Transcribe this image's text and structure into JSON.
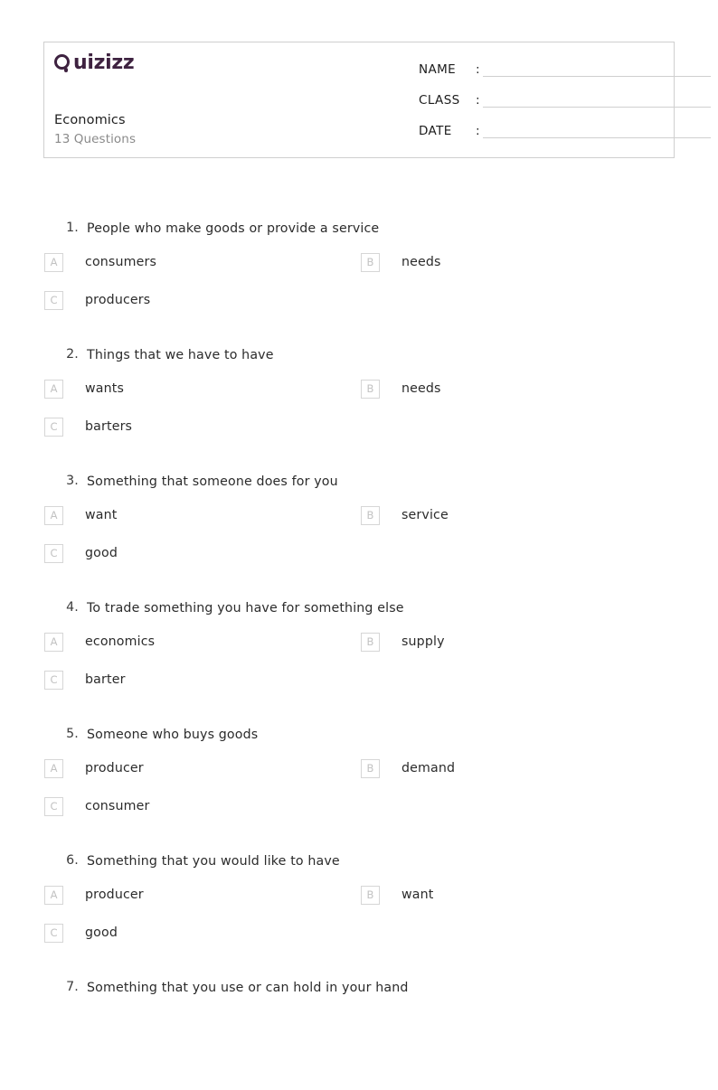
{
  "header": {
    "logo_text": "Quizizz",
    "logo_color": "#3e2240",
    "quiz_title": "Economics",
    "question_count_label": "13 Questions",
    "fields": [
      {
        "label": "NAME",
        "colon": ":",
        "value": ""
      },
      {
        "label": "CLASS",
        "colon": ":",
        "value": ""
      },
      {
        "label": "DATE",
        "colon": ":",
        "value": ""
      }
    ]
  },
  "questions": [
    {
      "number": "1.",
      "text": "People who make goods or provide a service",
      "options": [
        {
          "letter": "A",
          "text": "consumers"
        },
        {
          "letter": "B",
          "text": "needs"
        },
        {
          "letter": "C",
          "text": "producers"
        }
      ]
    },
    {
      "number": "2.",
      "text": "Things that we have to have",
      "options": [
        {
          "letter": "A",
          "text": "wants"
        },
        {
          "letter": "B",
          "text": "needs"
        },
        {
          "letter": "C",
          "text": "barters"
        }
      ]
    },
    {
      "number": "3.",
      "text": "Something that someone does for you",
      "options": [
        {
          "letter": "A",
          "text": "want"
        },
        {
          "letter": "B",
          "text": "service"
        },
        {
          "letter": "C",
          "text": "good"
        }
      ]
    },
    {
      "number": "4.",
      "text": "To trade something you have for something else",
      "options": [
        {
          "letter": "A",
          "text": "economics"
        },
        {
          "letter": "B",
          "text": "supply"
        },
        {
          "letter": "C",
          "text": "barter"
        }
      ]
    },
    {
      "number": "5.",
      "text": "Someone who buys goods",
      "options": [
        {
          "letter": "A",
          "text": "producer"
        },
        {
          "letter": "B",
          "text": "demand"
        },
        {
          "letter": "C",
          "text": "consumer"
        }
      ]
    },
    {
      "number": "6.",
      "text": "Something that you would like to have",
      "options": [
        {
          "letter": "A",
          "text": "producer"
        },
        {
          "letter": "B",
          "text": "want"
        },
        {
          "letter": "C",
          "text": "good"
        }
      ]
    },
    {
      "number": "7.",
      "text": "Something that you use or can hold in your hand",
      "options": []
    }
  ]
}
